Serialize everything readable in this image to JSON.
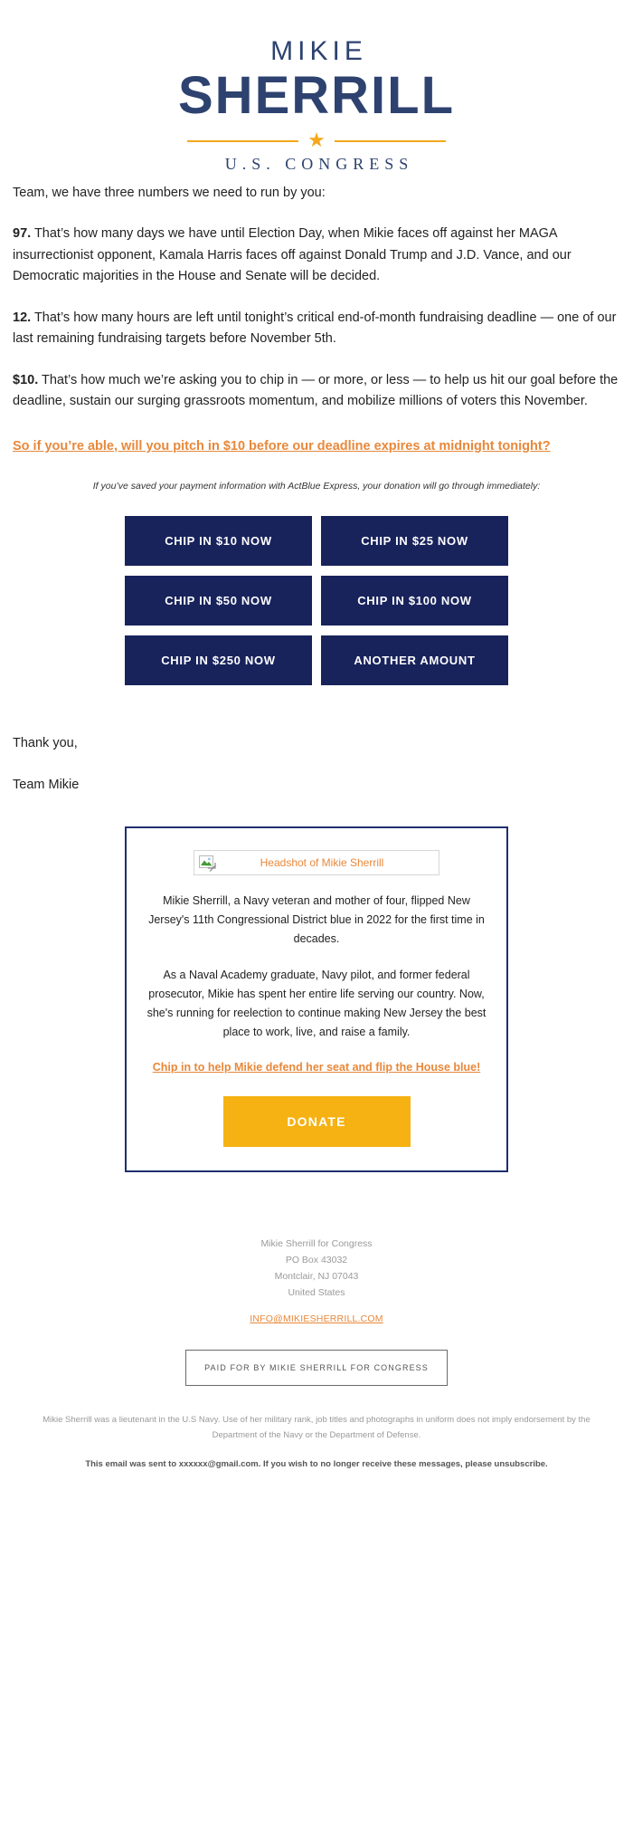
{
  "logo": {
    "first_name": "MIKIE",
    "last_name": "SHERRILL",
    "subtitle": "U.S. CONGRESS",
    "star_glyph": "★",
    "navy": "#2e4270",
    "gold": "#f5a81c"
  },
  "body": {
    "intro": "Team, we have three numbers we need to run by you:",
    "p1_lead": "97.",
    "p1_rest": " That’s how many days we have until Election Day, when Mikie faces off against her MAGA insurrectionist opponent, Kamala Harris faces off against Donald Trump and J.D. Vance, and our Democratic majorities in the House and Senate will be decided.",
    "p2_lead": "12.",
    "p2_rest": " That’s how many hours are left until tonight’s critical end-of-month fundraising deadline — one of our last remaining fundraising targets before November 5th.",
    "p3_lead": "$10.",
    "p3_rest": " That’s how much we’re asking you to chip in — or more, or less — to help us hit our goal before the deadline, sustain our surging grassroots momentum, and mobilize millions of voters this November.",
    "cta_link": "So if you’re able, will you pitch in $10 before our deadline expires at midnight tonight?",
    "actblue_note": "If you’ve saved your payment information with ActBlue Express, your donation will go through immediately:",
    "signoff_1": "Thank you,",
    "signoff_2": "Team Mikie"
  },
  "donate_buttons": [
    {
      "label": "CHIP IN $10 NOW"
    },
    {
      "label": "CHIP IN $25 NOW"
    },
    {
      "label": "CHIP IN $50 NOW"
    },
    {
      "label": "CHIP IN $100 NOW"
    },
    {
      "label": "CHIP IN $250 NOW"
    },
    {
      "label": "ANOTHER AMOUNT"
    }
  ],
  "bio_card": {
    "image_alt": "Headshot of Mikie Sherrill",
    "paragraph_1": "Mikie Sherrill, a Navy veteran and mother of four, flipped New Jersey's 11th Congressional District blue in 2022 for the first time in decades.",
    "paragraph_2": "As a Naval Academy graduate, Navy pilot, and former federal prosecutor, Mikie has spent her entire life serving our country. Now, she's running for reelection to continue making New Jersey the best place to work, live, and raise a family.",
    "link": "Chip in to help Mikie defend her seat and flip the House blue!",
    "donate_label": "DONATE",
    "border_color": "#1f2f6e",
    "donate_color": "#f5b212"
  },
  "footer": {
    "org": "Mikie Sherrill for Congress",
    "po_box": "PO Box 43032",
    "city_state_zip": "Montclair, NJ 07043",
    "country": "United States",
    "email": "INFO@MIKIESHERRILL.COM",
    "paid_for": "PAID FOR BY MIKIE SHERRILL FOR CONGRESS",
    "disclaimer": "Mikie Sherrill was a lieutenant in the U.S Navy. Use of her military rank, job titles and photographs in uniform does not imply endorsement by the Department of the Navy or the Department of Defense.",
    "unsubscribe": "This email was sent to xxxxxx@gmail.com. If you wish to no longer receive these messages, please unsubscribe."
  },
  "colors": {
    "accent_orange": "#e8883a",
    "navy_button": "#18235c",
    "gold": "#f5b212"
  }
}
